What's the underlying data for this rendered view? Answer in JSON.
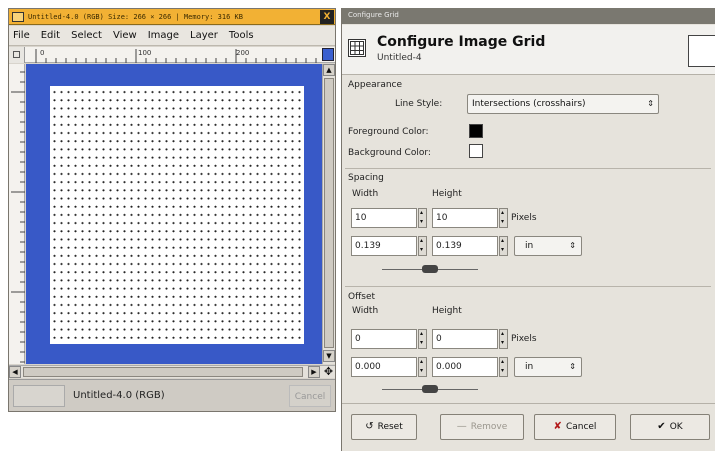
{
  "image_window": {
    "title": "Untitled-4.0 (RGB) Size: 266 × 266 | Memory: 316 KB",
    "close_glyph": "X",
    "menu": [
      "File",
      "Edit",
      "Select",
      "View",
      "Image",
      "Layer",
      "Tools"
    ],
    "ruler_marks": [
      "0",
      "100",
      "200"
    ],
    "status_text": "Untitled-4.0 (RGB)",
    "cancel_label": "Cancel"
  },
  "dialog": {
    "window_title": "Configure Grid",
    "title": "Configure Image Grid",
    "subtitle": "Untitled-4",
    "appearance": {
      "section_label": "Appearance",
      "line_style_label": "Line Style:",
      "line_style_value": "Intersections (crosshairs)",
      "foreground_label": "Foreground Color:",
      "foreground_color": "#000000",
      "background_label": "Background Color:",
      "background_color": "#ffffff"
    },
    "spacing": {
      "section_label": "Spacing",
      "width_label": "Width",
      "height_label": "Height",
      "width_px": "10",
      "height_px": "10",
      "px_unit": "Pixels",
      "width_in": "0.139",
      "height_in": "0.139",
      "in_unit": "in"
    },
    "offset": {
      "section_label": "Offset",
      "width_label": "Width",
      "height_label": "Height",
      "width_px": "0",
      "height_px": "0",
      "px_unit": "Pixels",
      "width_in": "0.000",
      "height_in": "0.000",
      "in_unit": "in"
    },
    "buttons": {
      "reset": "Reset",
      "remove": "Remove",
      "cancel": "Cancel",
      "ok": "OK"
    }
  },
  "colors": {
    "title_active": "#f2b134",
    "canvas_bg": "#3859c7"
  }
}
